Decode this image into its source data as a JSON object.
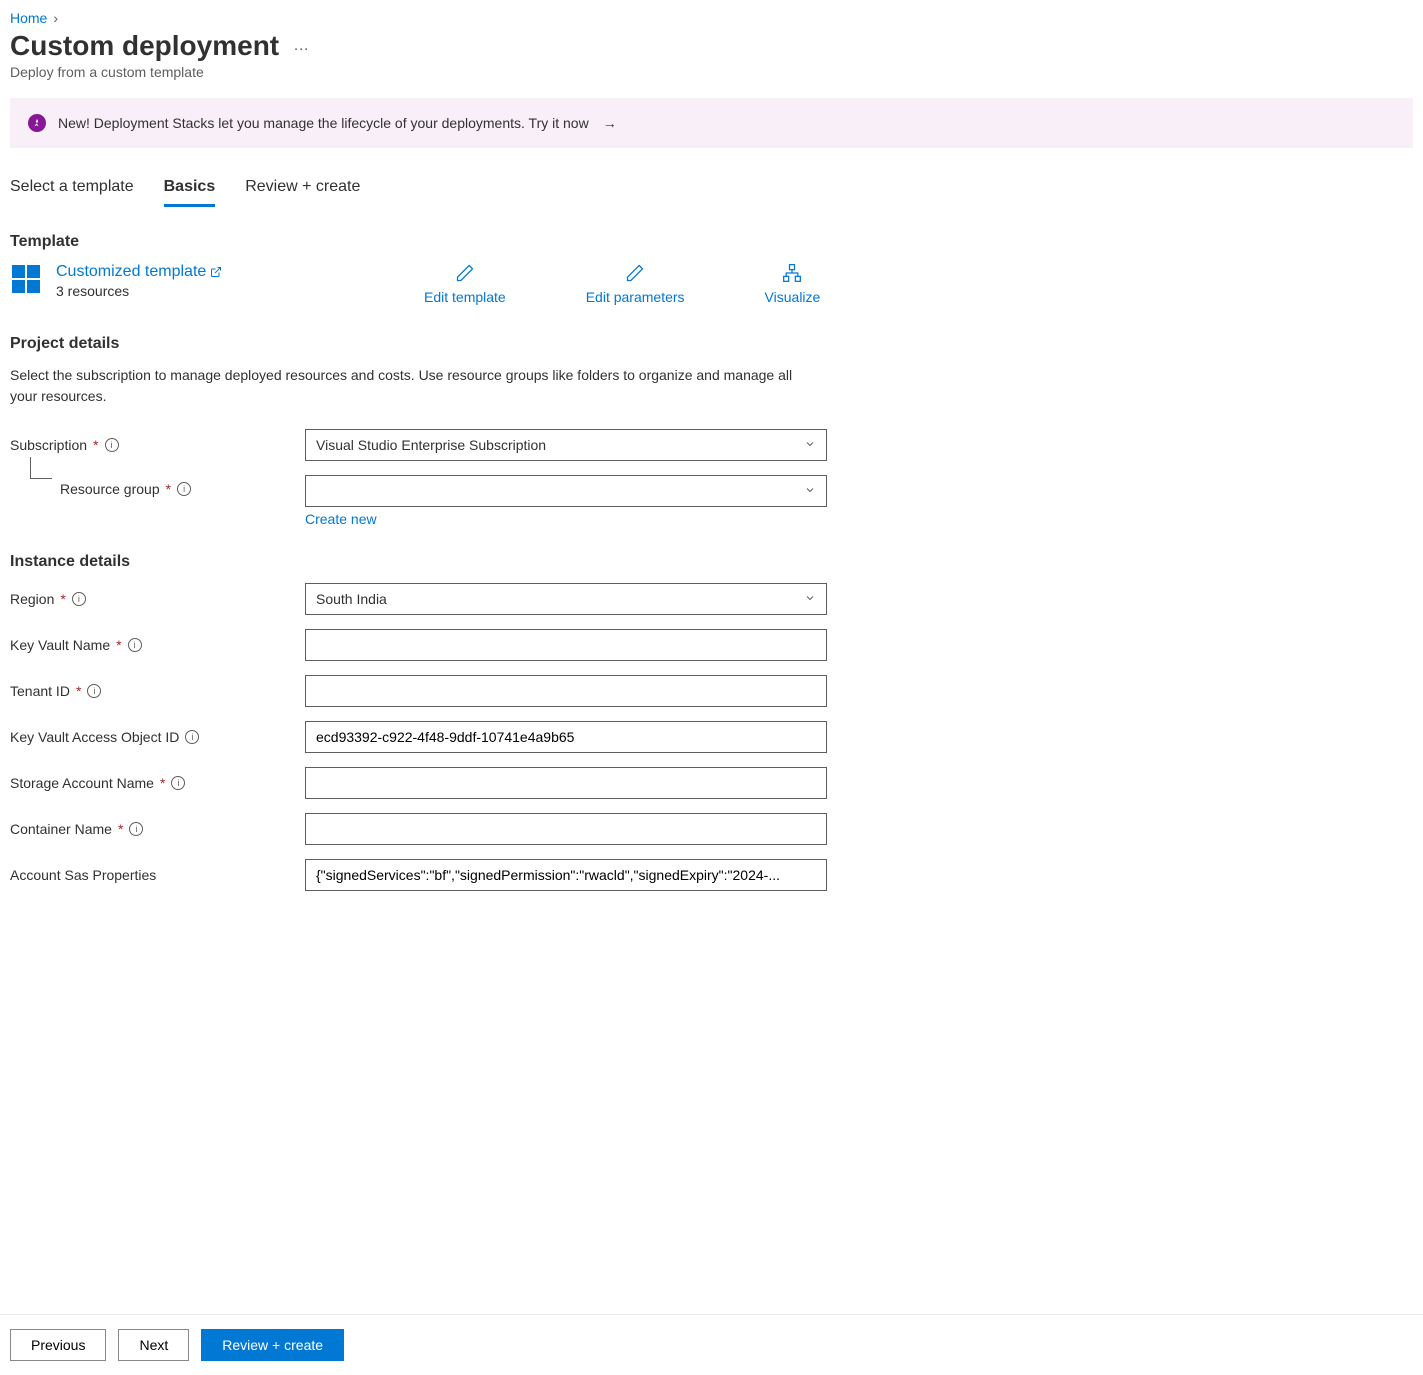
{
  "breadcrumb": {
    "home": "Home"
  },
  "page": {
    "title": "Custom deployment",
    "subtitle": "Deploy from a custom template"
  },
  "banner": {
    "text": "New! Deployment Stacks let you manage the lifecycle of your deployments. Try it now"
  },
  "tabs": {
    "select_template": "Select a template",
    "basics": "Basics",
    "review_create": "Review + create"
  },
  "template_section": {
    "heading": "Template",
    "link": "Customized template",
    "resources": "3 resources",
    "edit_template": "Edit template",
    "edit_parameters": "Edit parameters",
    "visualize": "Visualize"
  },
  "project": {
    "heading": "Project details",
    "description": "Select the subscription to manage deployed resources and costs. Use resource groups like folders to organize and manage all your resources.",
    "subscription_label": "Subscription",
    "subscription_value": "Visual Studio Enterprise Subscription",
    "resource_group_label": "Resource group",
    "resource_group_value": "",
    "create_new": "Create new"
  },
  "instance": {
    "heading": "Instance details",
    "region_label": "Region",
    "region_value": "South India",
    "key_vault_name_label": "Key Vault Name",
    "key_vault_name_value": "",
    "tenant_id_label": "Tenant ID",
    "tenant_id_value": "",
    "kv_access_object_id_label": "Key Vault Access Object ID",
    "kv_access_object_id_value": "ecd93392-c922-4f48-9ddf-10741e4a9b65",
    "storage_account_label": "Storage Account Name",
    "storage_account_value": "",
    "container_name_label": "Container Name",
    "container_name_value": "",
    "sas_label": "Account Sas Properties",
    "sas_value": "{\"signedServices\":\"bf\",\"signedPermission\":\"rwacld\",\"signedExpiry\":\"2024-..."
  },
  "footer": {
    "previous": "Previous",
    "next": "Next",
    "review_create": "Review + create"
  }
}
